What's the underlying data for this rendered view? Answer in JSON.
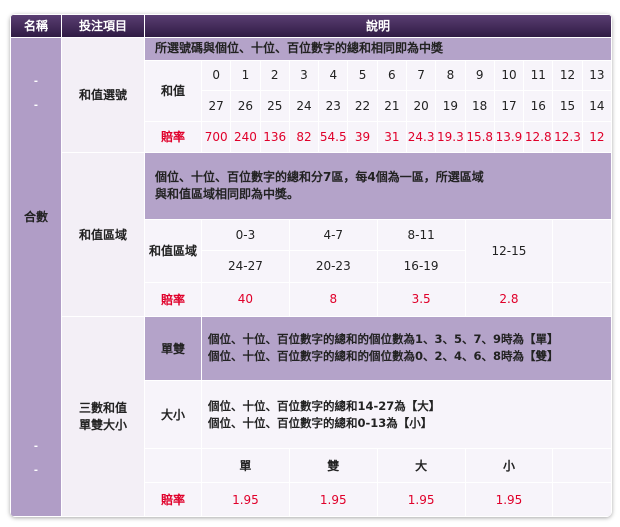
{
  "header": {
    "col_name": "名稱",
    "col_item": "投注項目",
    "col_desc": "說明"
  },
  "category": "合數",
  "side_marks": [
    "-",
    "-",
    "-",
    "-"
  ],
  "sum_select": {
    "label": "和值選號",
    "description": "所選號碼與個位、十位、百位數字的總和相同即為中獎",
    "sum_label": "和值",
    "row1": [
      "0",
      "1",
      "2",
      "3",
      "4",
      "5",
      "6",
      "7",
      "8",
      "9",
      "10",
      "11",
      "12",
      "13"
    ],
    "row2": [
      "27",
      "26",
      "25",
      "24",
      "23",
      "22",
      "21",
      "20",
      "19",
      "18",
      "17",
      "16",
      "15",
      "14"
    ],
    "odds_label": "賠率",
    "odds": [
      "700",
      "240",
      "136",
      "82",
      "54.5",
      "39",
      "31",
      "24.3",
      "19.3",
      "15.8",
      "13.9",
      "12.8",
      "12.3",
      "12"
    ]
  },
  "sum_zone": {
    "label": "和值區域",
    "description_line1": "個位、十位、百位數字的總和分7區，每4個為一區，所選區域",
    "description_line2": "與和值區域相同即為中獎。",
    "zone_label": "和值區域",
    "zones_top": [
      "0-3",
      "4-7",
      "8-11"
    ],
    "zones_bottom": [
      "24-27",
      "20-23",
      "16-19"
    ],
    "zone_mid": "12-15",
    "odds_label": "賠率",
    "odds": [
      "40",
      "8",
      "3.5",
      "2.8"
    ]
  },
  "odd_even_big_small": {
    "label_line1": "三數和值",
    "label_line2": "單雙大小",
    "odd_even_label": "單雙",
    "odd_even_desc1": "個位、十位、百位數字的總和的個位數為1、3、5、7、9時為【單】",
    "odd_even_desc2": "個位、十位、百位數字的總和的個位數為0、2、4、6、8時為【雙】",
    "big_small_label": "大小",
    "big_small_desc1": "個位、十位、百位數字的總和14-27為【大】",
    "big_small_desc2": "個位、十位、百位數字的總和0-13為【小】",
    "options": [
      "單",
      "雙",
      "大",
      "小"
    ],
    "odds_label": "賠率",
    "odds": [
      "1.95",
      "1.95",
      "1.95",
      "1.95"
    ]
  },
  "colors": {
    "header": "#3e2757",
    "purple": "#b09dc6",
    "red": "#e0002a"
  }
}
